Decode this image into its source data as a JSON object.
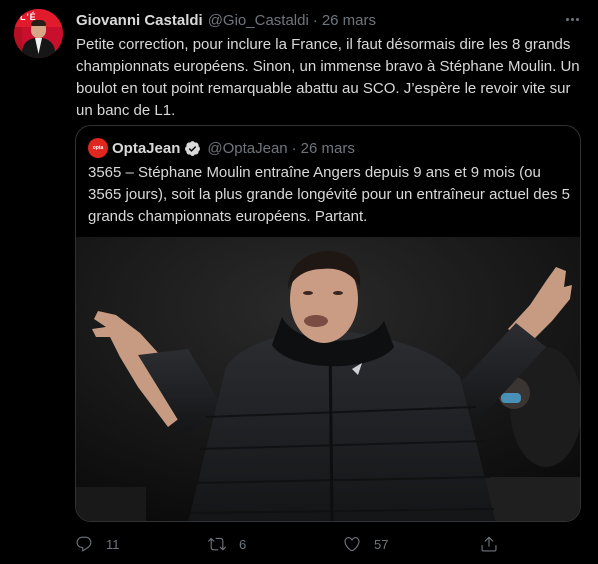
{
  "tweet": {
    "author_name": "Giovanni Castaldi",
    "author_handle": "@Gio_Castaldi",
    "separator": "·",
    "date": "26 mars",
    "text": "Petite correction, pour inclure la France, il faut désormais dire les 8 grands championnats européens. Sinon, un immense bravo à Stéphane Moulin. Un boulot en tout point remarquable abattu au SCO. J’espère le revoir vite sur un banc de L1.",
    "avatar_text": "L'É"
  },
  "quote": {
    "avatar_text": "opta",
    "author_name": "OptaJean",
    "author_handle": "@OptaJean",
    "separator": "·",
    "date": "26 mars",
    "text": "3565 – Stéphane Moulin entraîne Angers depuis 9 ans et 9 mois (ou 3565 jours), soit la plus grande longévité pour un entraîneur actuel des 5 grands championnats européens. Partant."
  },
  "actions": {
    "reply_count": "11",
    "retweet_count": "6",
    "like_count": "57"
  },
  "icons": {
    "more": "more-icon",
    "verified": "verified-badge-icon",
    "reply": "reply-icon",
    "retweet": "retweet-icon",
    "like": "heart-icon",
    "share": "share-icon"
  },
  "colors": {
    "background": "#000000",
    "text": "#d9d9d9",
    "muted": "#6e767d",
    "border": "#2f3336",
    "verified": "#d9d9d9"
  }
}
